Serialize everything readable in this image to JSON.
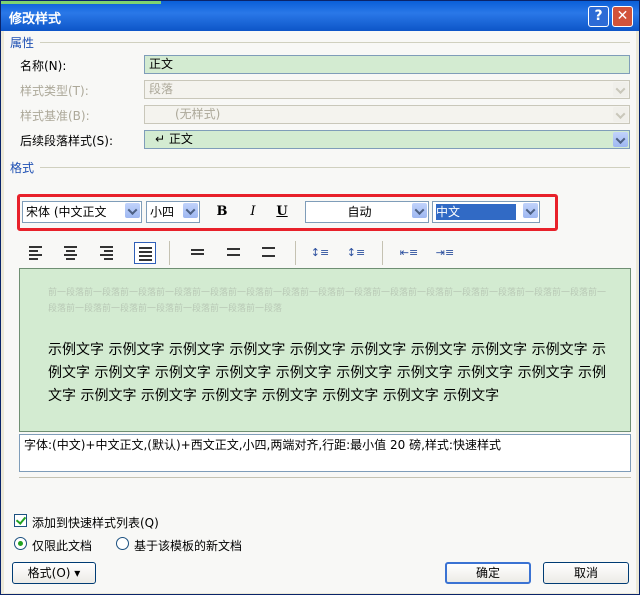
{
  "window": {
    "title": "修改样式"
  },
  "properties": {
    "group_label": "属性",
    "name_label": "名称(N):",
    "name_value": "正文",
    "type_label": "样式类型(T):",
    "type_value": "段落",
    "base_label": "样式基准(B):",
    "base_value": "(无样式)",
    "next_label": "后续段落样式(S):",
    "next_value": "↵ 正文"
  },
  "format": {
    "group_label": "格式",
    "font": "宋体 (中文正文",
    "size": "小四",
    "bold": "B",
    "italic": "I",
    "underline": "U",
    "color": "自动",
    "script": "中文"
  },
  "preview": {
    "ghost_text": "前一段落前一段落前一段落前一段落前一段落前一段落前一段落前一段落前一段落前一段落前一段落前一段落前一段落前一段落前一段落前一段落前一段落前一段落前一段落前一段落前一段落前一段落",
    "sample_text": "示例文字 示例文字 示例文字 示例文字 示例文字 示例文字 示例文字 示例文字 示例文字 示例文字 示例文字 示例文字 示例文字 示例文字 示例文字 示例文字 示例文字 示例文字 示例文字 示例文字 示例文字 示例文字 示例文字 示例文字 示例文字 示例文字"
  },
  "description": "字体:(中文)+中文正文,(默认)+西文正文,小四,两端对齐,行距:最小值 20 磅,样式:快速样式",
  "options": {
    "add_quick": "添加到快速样式列表(Q)",
    "only_doc": "仅限此文档",
    "template_docs": "基于该模板的新文档"
  },
  "buttons": {
    "format": "格式(O) ▾",
    "ok": "确定",
    "cancel": "取消"
  }
}
